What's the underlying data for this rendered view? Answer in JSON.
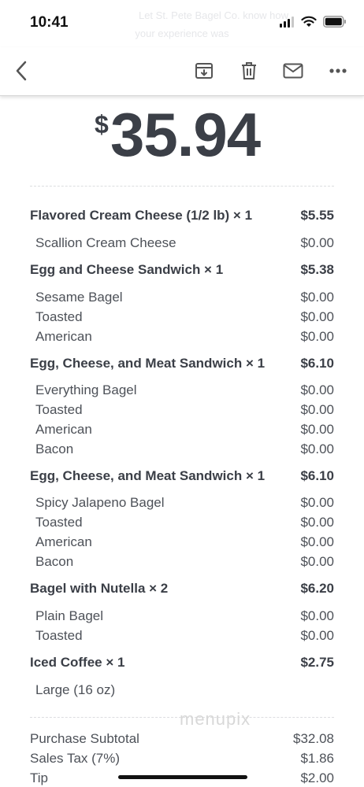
{
  "status": {
    "time": "10:41"
  },
  "banner_ghost": {
    "line1": "Let St. Pete Bagel Co. know how",
    "line2": "your experience was"
  },
  "toolbar": {
    "icons": [
      "back-icon",
      "archive-icon",
      "trash-icon",
      "mail-icon",
      "more-icon"
    ]
  },
  "total": {
    "currency": "$",
    "amount": "35.94"
  },
  "items": [
    {
      "name": "Flavored Cream Cheese (1/2 lb) × 1",
      "price": "$5.55",
      "mods": [
        {
          "name": "Scallion Cream Cheese",
          "price": "$0.00"
        }
      ]
    },
    {
      "name": "Egg and Cheese Sandwich × 1",
      "price": "$5.38",
      "mods": [
        {
          "name": "Sesame Bagel",
          "price": "$0.00"
        },
        {
          "name": "Toasted",
          "price": "$0.00"
        },
        {
          "name": "American",
          "price": "$0.00"
        }
      ]
    },
    {
      "name": "Egg, Cheese, and Meat Sandwich × 1",
      "price": "$6.10",
      "mods": [
        {
          "name": "Everything Bagel",
          "price": "$0.00"
        },
        {
          "name": "Toasted",
          "price": "$0.00"
        },
        {
          "name": "American",
          "price": "$0.00"
        },
        {
          "name": "Bacon",
          "price": "$0.00"
        }
      ]
    },
    {
      "name": "Egg, Cheese, and Meat Sandwich × 1",
      "price": "$6.10",
      "mods": [
        {
          "name": "Spicy Jalapeno Bagel",
          "price": "$0.00"
        },
        {
          "name": "Toasted",
          "price": "$0.00"
        },
        {
          "name": "American",
          "price": "$0.00"
        },
        {
          "name": "Bacon",
          "price": "$0.00"
        }
      ]
    },
    {
      "name": "Bagel with Nutella × 2",
      "price": "$6.20",
      "mods": [
        {
          "name": "Plain Bagel",
          "price": "$0.00"
        },
        {
          "name": "Toasted",
          "price": "$0.00"
        }
      ]
    },
    {
      "name": "Iced Coffee × 1",
      "price": "$2.75",
      "mods": [
        {
          "name": "Large (16 oz)",
          "price": ""
        }
      ]
    }
  ],
  "summary": [
    {
      "label": "Purchase Subtotal",
      "value": "$32.08"
    },
    {
      "label": "Sales Tax (7%)",
      "value": "$1.86"
    },
    {
      "label": "Tip",
      "value": "$2.00"
    }
  ],
  "watermark": "menupix"
}
